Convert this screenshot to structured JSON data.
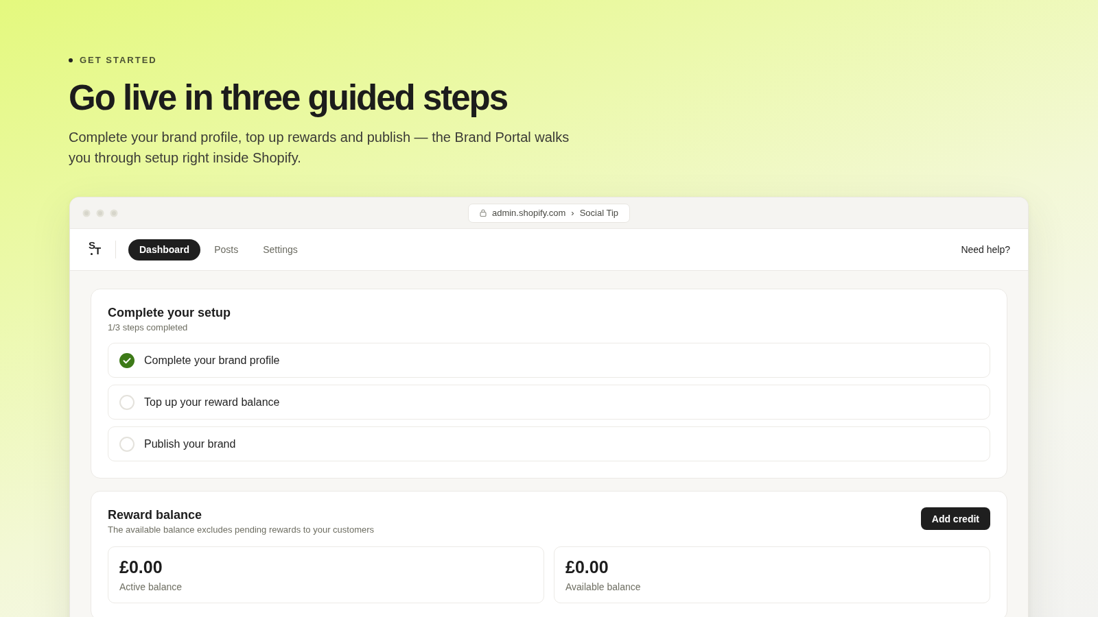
{
  "eyebrow": "GET STARTED",
  "headline": "Go live in three guided steps",
  "intro": "Complete your brand profile, top up rewards and publish — the Brand Portal walks you through setup right inside Shopify.",
  "browser": {
    "address": "admin.shopify.com",
    "separator": "›",
    "page": "Social Tip"
  },
  "app": {
    "logo": "ST",
    "tabs": [
      {
        "label": "Dashboard",
        "selected": true
      },
      {
        "label": "Posts",
        "selected": false
      },
      {
        "label": "Settings",
        "selected": false
      }
    ],
    "help_link": "Need help?"
  },
  "setup": {
    "title": "Complete your setup",
    "progress": "1/3 steps completed",
    "steps": [
      {
        "label": "Complete your brand profile",
        "checked": true
      },
      {
        "label": "Top up your reward balance",
        "checked": false
      },
      {
        "label": "Publish your brand",
        "checked": false
      }
    ]
  },
  "reward": {
    "title": "Reward balance",
    "description": "The available balance excludes pending rewards to your customers",
    "button": "Add credit",
    "balances": [
      {
        "amount": "£0.00",
        "label": "Active balance"
      },
      {
        "amount": "£0.00",
        "label": "Available balance"
      }
    ]
  }
}
